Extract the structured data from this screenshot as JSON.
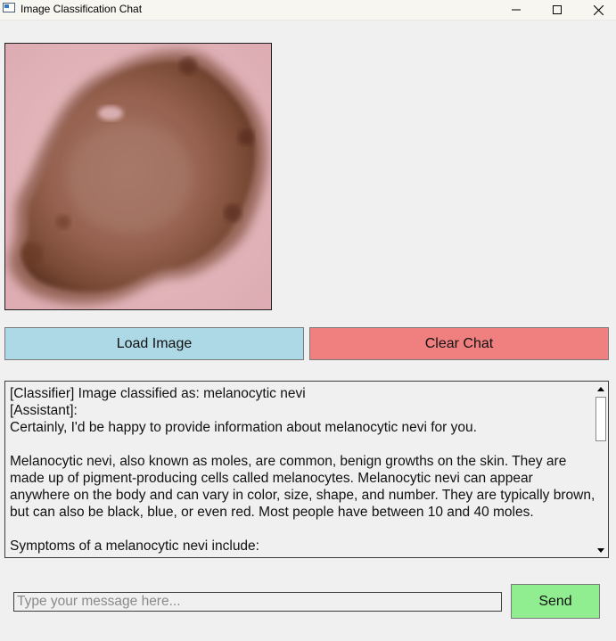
{
  "window": {
    "title": "Image Classification Chat",
    "icon": "app-window-icon",
    "controls": [
      "minimize-icon",
      "maximize-icon",
      "close-icon"
    ]
  },
  "image_panel": {
    "image_description": "dermoscopic skin lesion image"
  },
  "buttons": {
    "load_label": "Load Image",
    "clear_label": "Clear Chat",
    "send_label": "Send"
  },
  "colors": {
    "load_button": "#add8e6",
    "clear_button": "#f08080",
    "send_button": "#90ee90"
  },
  "chat": {
    "lines": [
      "[Classifier] Image classified as: melanocytic nevi",
      "[Assistant]:",
      "Certainly, I'd be happy to provide information about melanocytic nevi for you.",
      "",
      "Melanocytic nevi, also known as moles, are common, benign growths on the skin. They are",
      "made up of pigment-producing cells called melanocytes. Melanocytic nevi can appear",
      "anywhere on the body and can vary in color, size, shape, and number. They are typically brown,",
      "but can also be black, blue, or even red. Most people have between 10 and 40 moles.",
      "",
      "Symptoms of a melanocytic nevi include:"
    ]
  },
  "input": {
    "placeholder": "Type your message here...",
    "value": ""
  }
}
